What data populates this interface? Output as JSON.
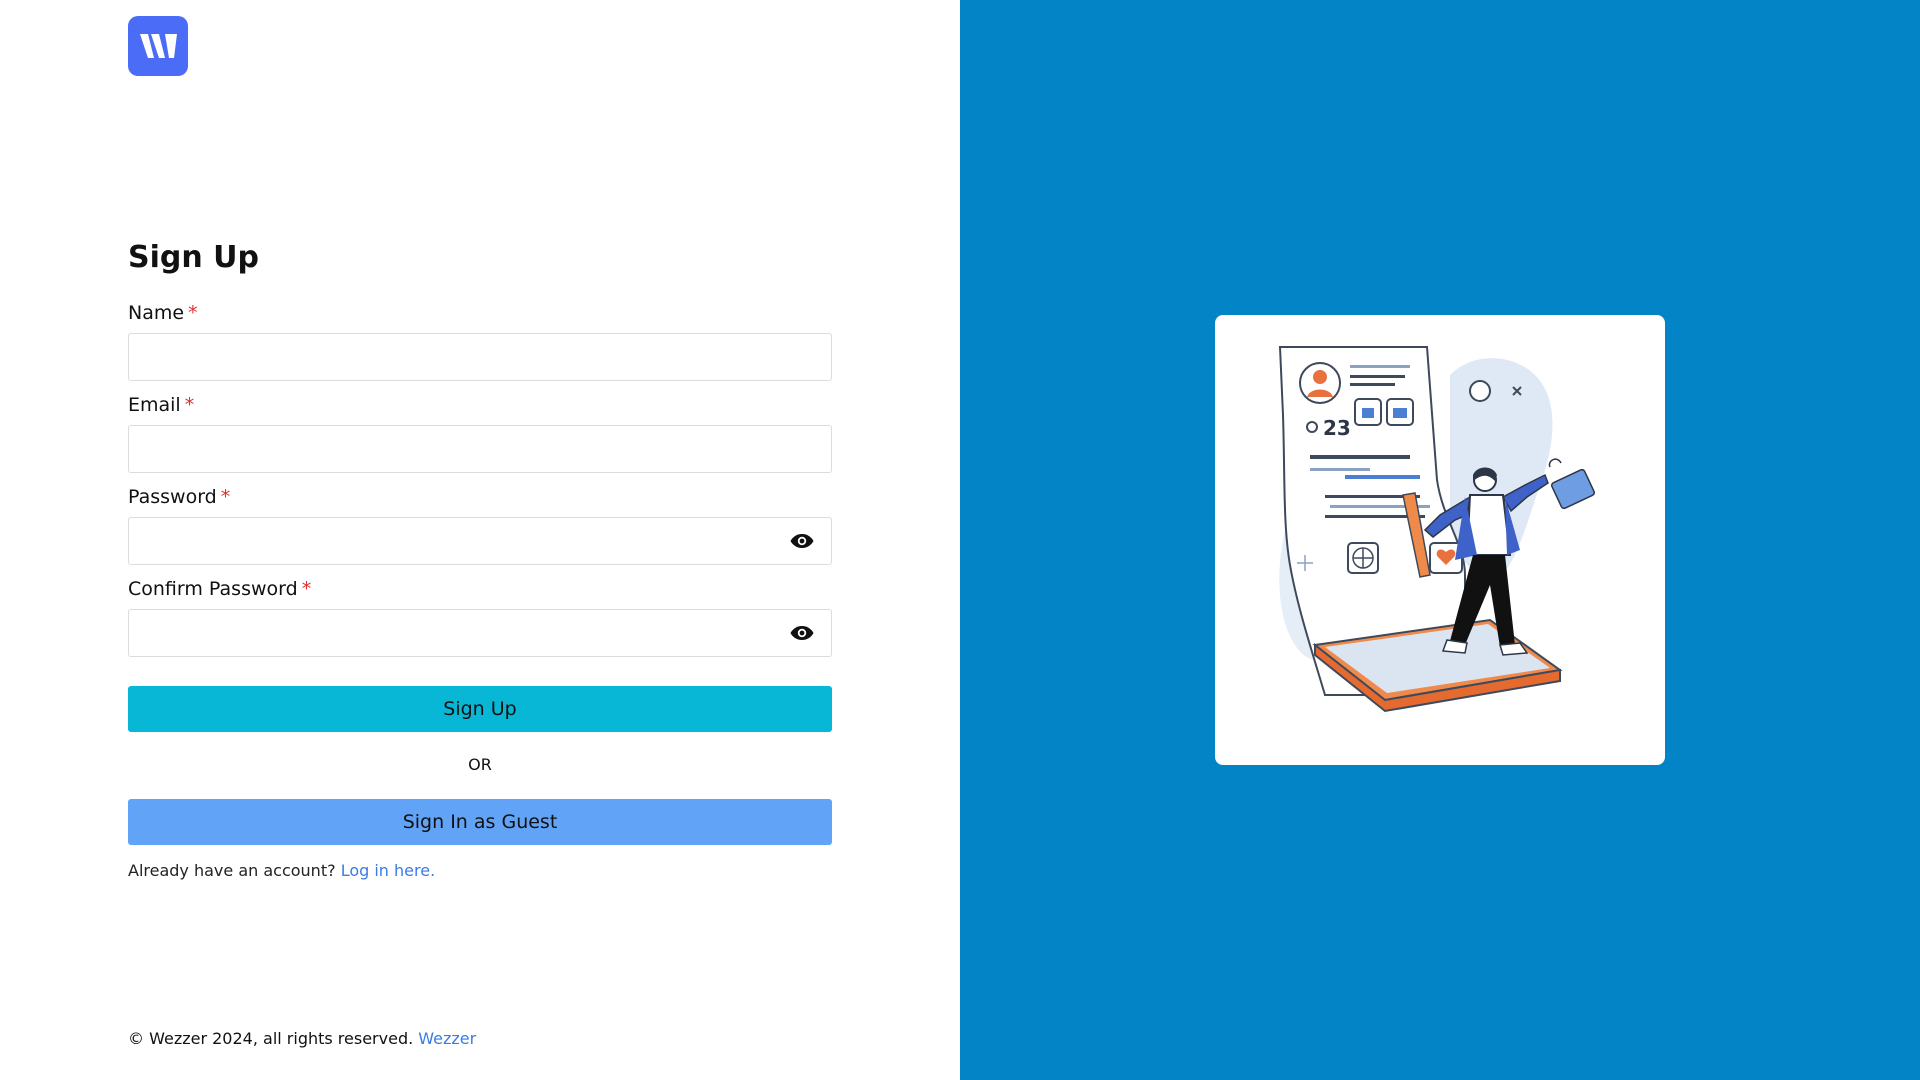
{
  "brand": {
    "logo_icon": "wezzer-w-logo",
    "logo_color": "#4a6cf7"
  },
  "form": {
    "title": "Sign Up",
    "required_marker": "*",
    "fields": [
      {
        "label": "Name",
        "value": "",
        "placeholder": ""
      },
      {
        "label": "Email",
        "value": "",
        "placeholder": ""
      },
      {
        "label": "Password",
        "value": "",
        "placeholder": "",
        "icon": "eye-icon"
      },
      {
        "label": "Confirm Password",
        "value": "",
        "placeholder": "",
        "icon": "eye-icon"
      }
    ],
    "signup_button": "Sign Up",
    "or_text": "OR",
    "guest_button": "Sign In as Guest",
    "account_prompt": "Already have an account?",
    "login_link": "Log in here."
  },
  "footer": {
    "copyright": "© Wezzer 2024, all rights reserved.",
    "brand_link": "Wezzer"
  },
  "illustration": {
    "card_text": "23"
  },
  "colors": {
    "right_panel": "#0384c6",
    "signup_button": "#08b6d6",
    "guest_button": "#61a3f7",
    "link": "#3a7be8",
    "required": "#e03131"
  }
}
